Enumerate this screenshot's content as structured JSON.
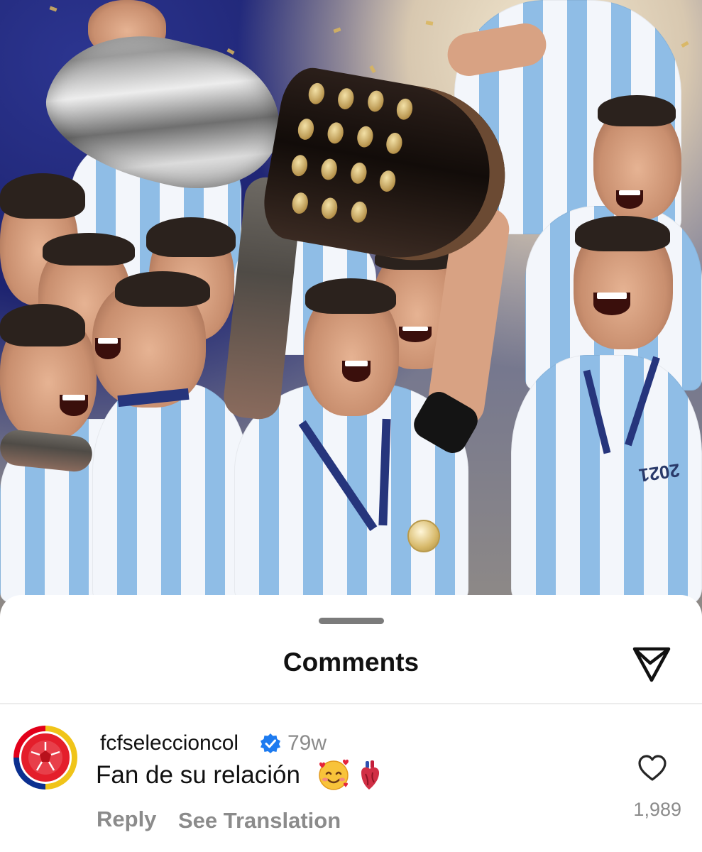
{
  "photo": {
    "subject": "team-celebration-with-trophy",
    "colors": {
      "jersey_blue": "#8fbde6",
      "jersey_white": "#f3f6fb",
      "lanyard": "#26357c",
      "trophy_silver": "#bdbdbd",
      "trophy_base": "#1a120e"
    },
    "jersey_text": "2021"
  },
  "sheet": {
    "title": "Comments",
    "share_icon": "send-icon"
  },
  "comment": {
    "username": "fcfseleccioncol",
    "verified": true,
    "verified_color": "#1d7bf0",
    "timestamp": "79w",
    "text": "Fan de su relación",
    "emojis": [
      "smiling-face-with-hearts",
      "anatomical-heart"
    ],
    "reply_label": "Reply",
    "translate_label": "See Translation",
    "like_count": "1,989",
    "avatar": "colombia-federation-logo"
  }
}
